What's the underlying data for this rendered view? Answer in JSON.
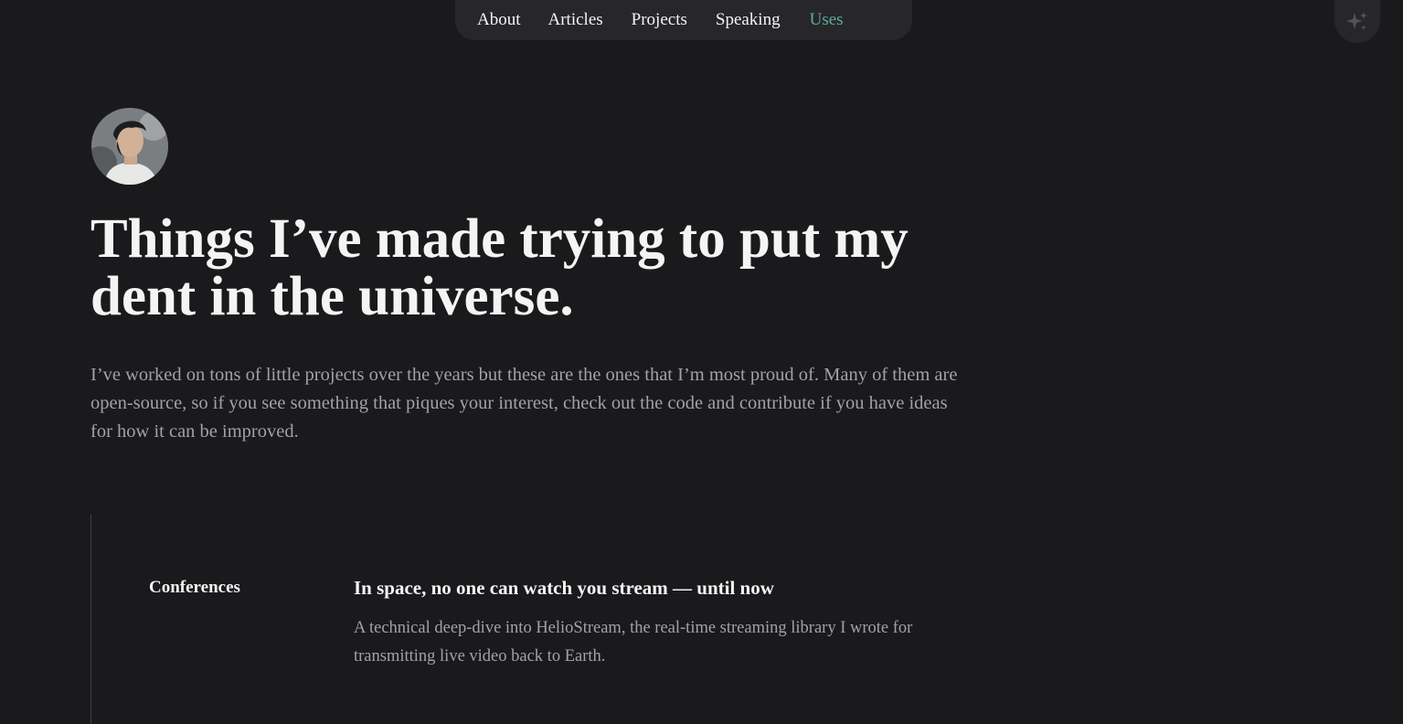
{
  "nav": {
    "items": [
      {
        "label": "About"
      },
      {
        "label": "Articles"
      },
      {
        "label": "Projects"
      },
      {
        "label": "Speaking"
      },
      {
        "label": "Uses"
      }
    ],
    "active": "Uses"
  },
  "theme_toggle": {
    "icon": "sparkles-icon"
  },
  "avatar": {
    "icon": "avatar"
  },
  "hero": {
    "title": "Things I’ve made trying to put my dent in the universe.",
    "intro": "I’ve worked on tons of little projects over the years but these are the ones that I’m most proud of. Many of them are open-source, so if you see something that piques your interest, check out the code and contribute if you have ideas for how it can be improved."
  },
  "projects": [
    {
      "category": "Conferences",
      "title": "In space, no one can watch you stream — until now",
      "description": "A technical deep-dive into HelioStream, the real-time streaming library I wrote for transmitting live video back to Earth."
    }
  ],
  "colors": {
    "background": "#1a1a1c",
    "nav_bg": "#27272a",
    "accent": "#5eaaa0",
    "text": "#f4f4f5",
    "muted": "#a1a1aa"
  }
}
